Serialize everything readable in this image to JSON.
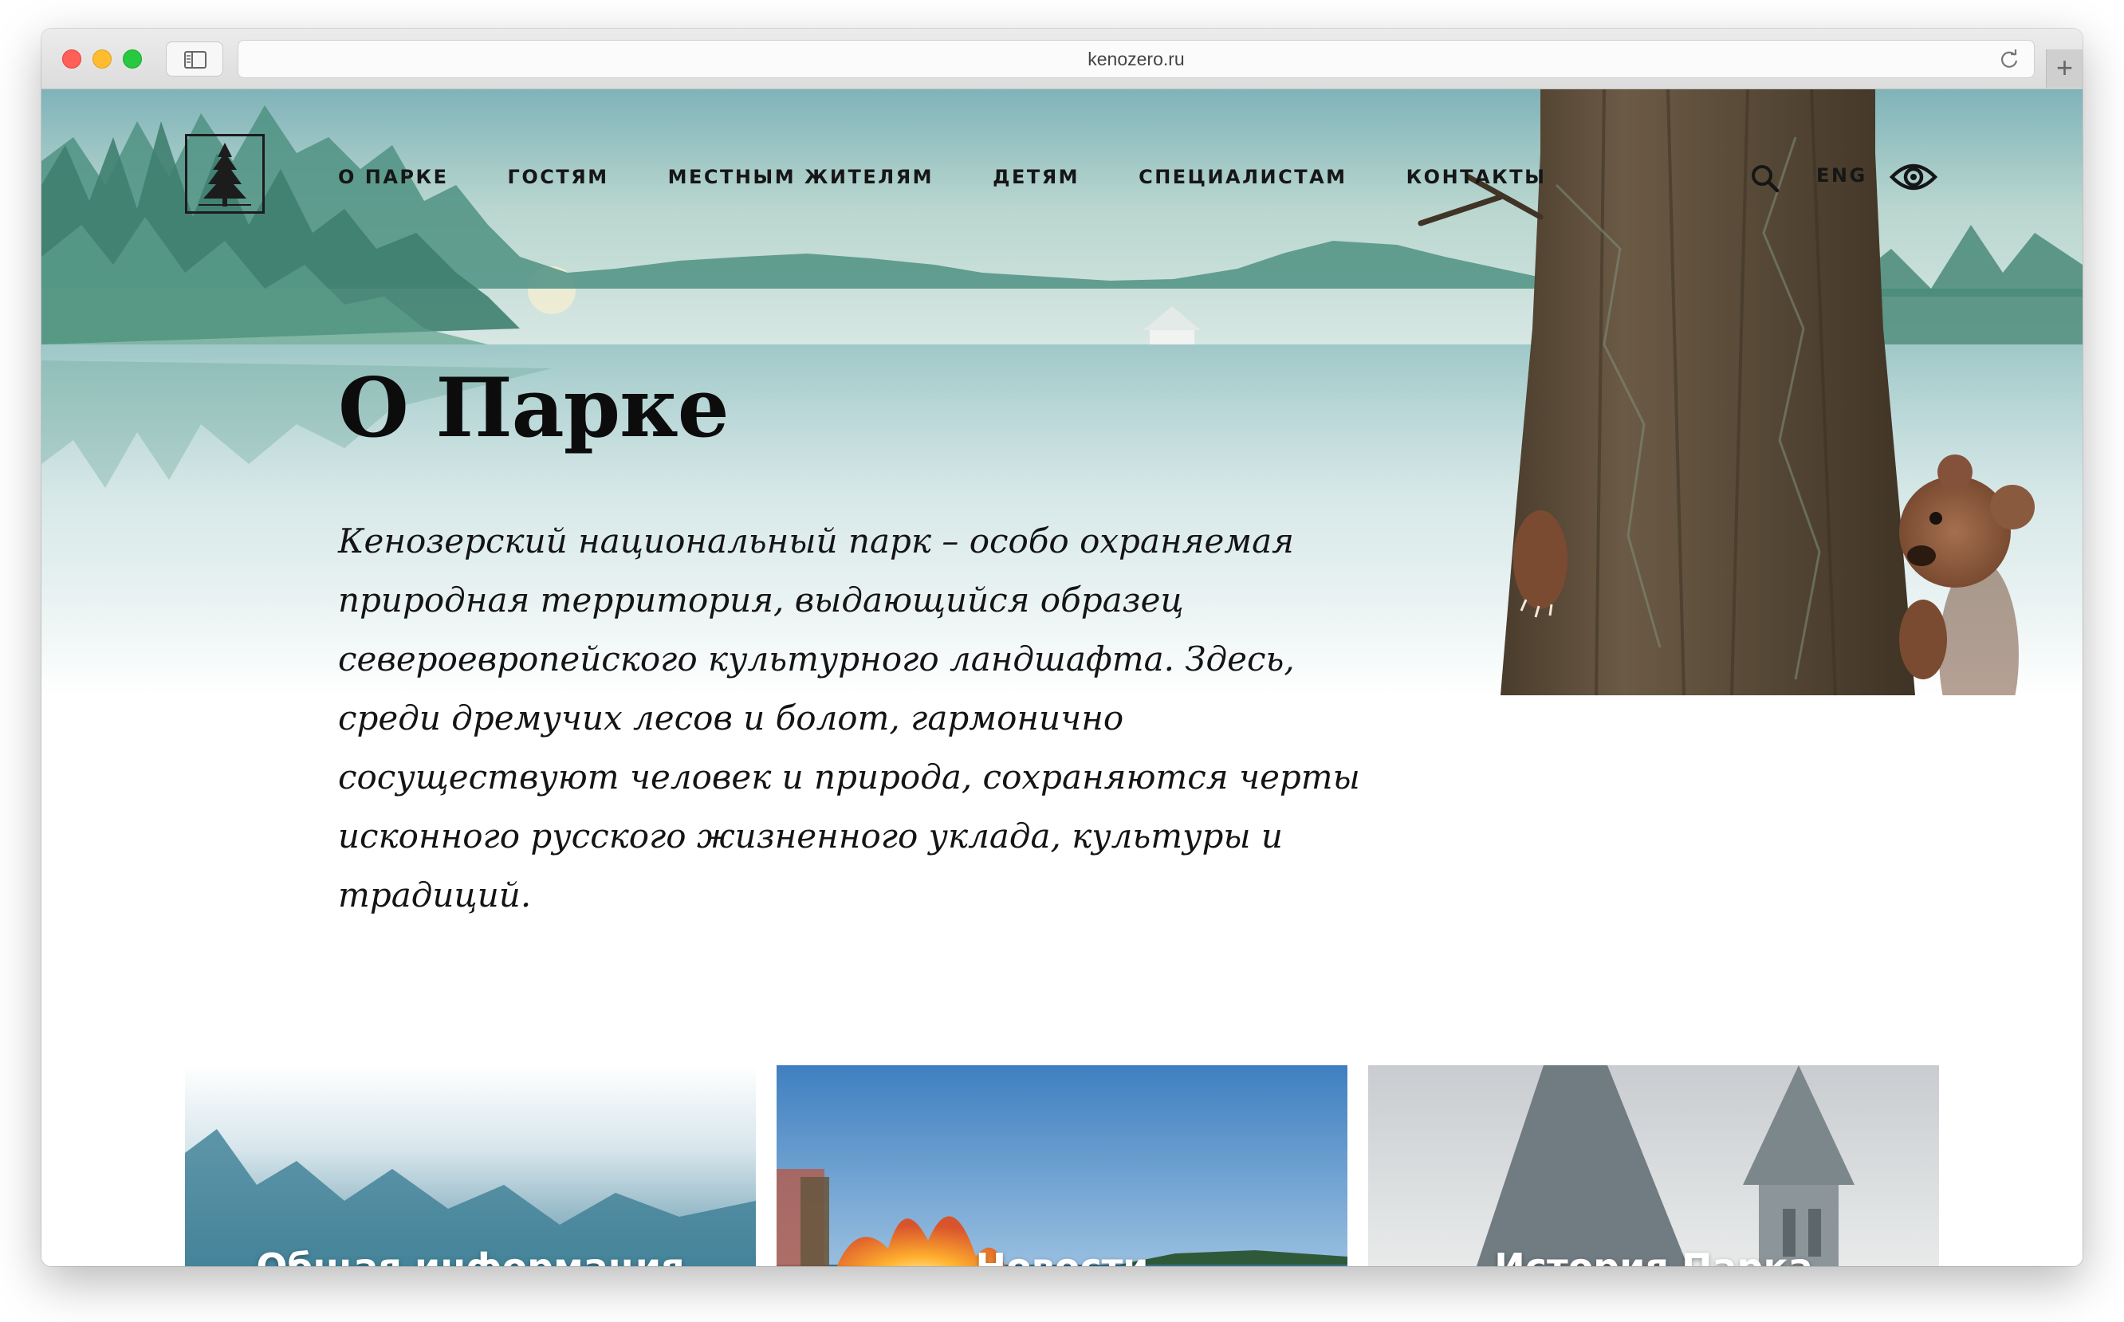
{
  "browser": {
    "url": "kenozero.ru"
  },
  "header": {
    "nav": [
      "О ПАРКЕ",
      "ГОСТЯМ",
      "МЕСТНЫМ ЖИТЕЛЯМ",
      "ДЕТЯМ",
      "СПЕЦИАЛИСТАМ",
      "КОНТАКТЫ"
    ],
    "lang": "ENG",
    "icons": [
      "search-icon",
      "eye-icon"
    ]
  },
  "main": {
    "title": "О Парке",
    "intro": "Кенозерский национальный парк – особо охраняемая природная территория, выдающийся образец североевропейского культурного ландшафта. Здесь, среди дремучих лесов и болот, гармонично сосуществуют человек и природа, сохраняются черты исконного русского жизненного уклада, культуры и традиций."
  },
  "cards": [
    {
      "label": "Общая информация"
    },
    {
      "label": "Новости"
    },
    {
      "label": "История Парка"
    }
  ],
  "colors": {
    "text": "#141414",
    "sky": "#8cc0c6",
    "forest": "#4d8f80",
    "trunk": "#5b4a36",
    "bear": "#8a5a3e"
  }
}
